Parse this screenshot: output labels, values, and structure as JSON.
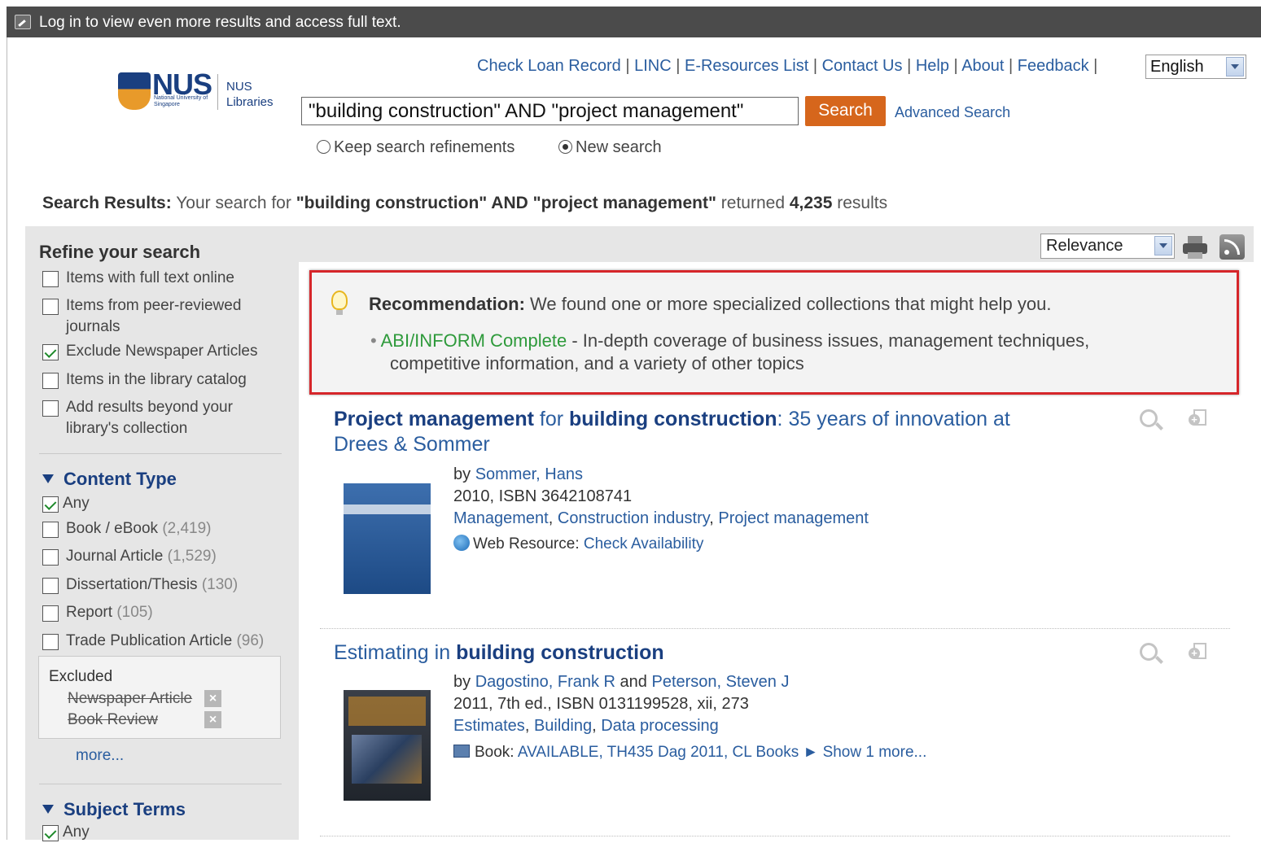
{
  "topbar": {
    "message": "Log in to view even more results and access full text."
  },
  "logo": {
    "name": "NUS",
    "sub": "National University of Singapore",
    "lib1": "NUS",
    "lib2": "Libraries"
  },
  "toplinks": [
    "Check Loan Record",
    "LINC",
    "E-Resources List",
    "Contact Us",
    "Help",
    "About",
    "Feedback"
  ],
  "language": "English",
  "search": {
    "query": "\"building construction\" AND \"project management\"",
    "button": "Search",
    "advanced": "Advanced Search",
    "radio_keep": "Keep search refinements",
    "radio_new": "New search"
  },
  "summary": {
    "label": "Search Results:",
    "text1": "Your search for",
    "query": "\"building construction\" AND \"project management\"",
    "text2": "returned",
    "count": "4,235",
    "text3": "results"
  },
  "refine": {
    "title": "Refine your search",
    "options": [
      {
        "label": "Items with full text online",
        "checked": false
      },
      {
        "label": "Items from peer-reviewed",
        "label2": "journals",
        "checked": false
      },
      {
        "label": "Exclude Newspaper Articles",
        "checked": true
      },
      {
        "label": "Items in the library catalog",
        "checked": false
      },
      {
        "label": "Add results beyond your",
        "label2": "library's collection",
        "checked": false
      }
    ],
    "content_type": {
      "title": "Content Type",
      "any": "Any",
      "items": [
        {
          "label": "Book / eBook",
          "count": "(2,419)"
        },
        {
          "label": "Journal Article",
          "count": "(1,529)"
        },
        {
          "label": "Dissertation/Thesis",
          "count": "(130)"
        },
        {
          "label": "Report",
          "count": "(105)"
        },
        {
          "label": "Trade Publication Article",
          "count": "(96)"
        }
      ]
    },
    "excluded": {
      "title": "Excluded",
      "items": [
        "Newspaper Article",
        "Book Review"
      ]
    },
    "more": "more...",
    "subject_terms": {
      "title": "Subject Terms",
      "any": "Any"
    }
  },
  "sort": "Relevance",
  "recommendation": {
    "label": "Recommendation:",
    "text": "We found one or more specialized collections that might help you.",
    "bullet": "•",
    "link": "ABI/INFORM Complete",
    "desc1": "- In-depth coverage of business issues, management techniques,",
    "desc2": "competitive information, and a variety of other topics"
  },
  "results": [
    {
      "title_b1": "Project management",
      "title_t1": "for",
      "title_b2": "building construction",
      "title_t2": ": 35 years of innovation at",
      "title_line2": "Drees & Sommer",
      "by": "by",
      "authors": "Sommer, Hans",
      "pub": "2010, ISBN 3642108741",
      "subjects": [
        "Management",
        "Construction industry",
        "Project management"
      ],
      "format": "Web Resource:",
      "avail": "Check Availability"
    },
    {
      "title_t1": "Estimating in",
      "title_b1": "building construction",
      "by": "by",
      "author1": "Dagostino, Frank R",
      "and": "and",
      "author2": "Peterson, Steven J",
      "pub": "2011, 7th ed., ISBN 0131199528, xii, 273",
      "subjects": [
        "Estimates",
        "Building",
        "Data processing"
      ],
      "format": "Book:",
      "avail": "AVAILABLE, TH435 Dag 2011, CL Books",
      "showmore": "► Show 1 more..."
    }
  ]
}
